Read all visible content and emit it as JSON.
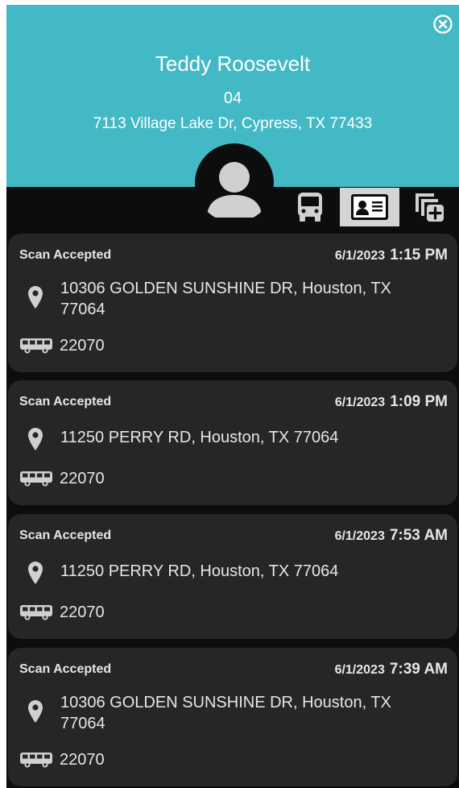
{
  "student": {
    "name": "Teddy Roosevelt",
    "grade": "04",
    "address": "7113 Village Lake Dr, Cypress, TX 77433"
  },
  "colors": {
    "header_bg": "#43b9c5",
    "panel_bg": "#0d0d0d",
    "card_bg": "#262626",
    "text": "#e6e6e6",
    "tab_active_bg": "#d4d4d4"
  },
  "tabs": [
    {
      "name": "bus-icon",
      "active": false
    },
    {
      "name": "id-card-icon",
      "active": true
    },
    {
      "name": "multi-add-icon",
      "active": false
    }
  ],
  "scans": [
    {
      "status": "Scan Accepted",
      "date": "6/1/2023",
      "time": "1:15 PM",
      "address": "10306 GOLDEN SUNSHINE DR, Houston, TX 77064",
      "bus": "22070"
    },
    {
      "status": "Scan Accepted",
      "date": "6/1/2023",
      "time": "1:09 PM",
      "address": "11250 PERRY RD, Houston, TX 77064",
      "bus": "22070"
    },
    {
      "status": "Scan Accepted",
      "date": "6/1/2023",
      "time": "7:53 AM",
      "address": "11250 PERRY RD, Houston, TX 77064",
      "bus": "22070"
    },
    {
      "status": "Scan Accepted",
      "date": "6/1/2023",
      "time": "7:39 AM",
      "address": "10306 GOLDEN SUNSHINE DR, Houston, TX 77064",
      "bus": "22070"
    }
  ]
}
